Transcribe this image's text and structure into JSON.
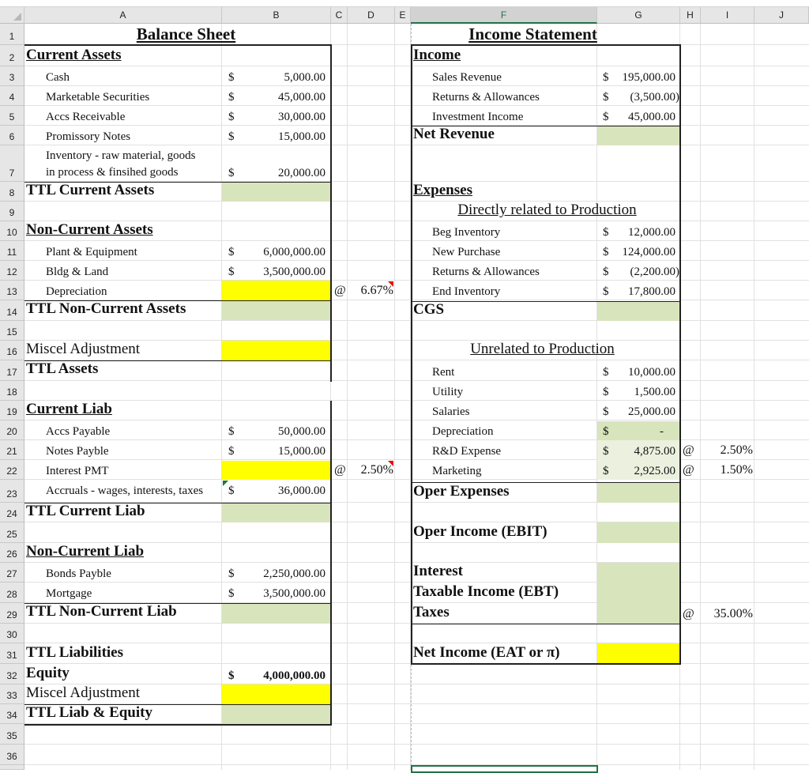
{
  "columns": [
    "A",
    "B",
    "C",
    "D",
    "E",
    "F",
    "G",
    "H",
    "I",
    "J"
  ],
  "rows": [
    "1",
    "2",
    "3",
    "4",
    "5",
    "6",
    "7",
    "8",
    "9",
    "10",
    "11",
    "12",
    "13",
    "14",
    "15",
    "16",
    "17",
    "18",
    "19",
    "20",
    "21",
    "22",
    "23",
    "24",
    "25",
    "26",
    "27",
    "28",
    "29",
    "30",
    "31",
    "32",
    "33",
    "34",
    "35",
    "36"
  ],
  "balance_sheet": {
    "title": "Balance Sheet",
    "current_assets_header": "Current Assets",
    "current_assets": [
      {
        "label": "Cash",
        "currency": "$",
        "value": "5,000.00"
      },
      {
        "label": "Marketable Securities",
        "currency": "$",
        "value": "45,000.00"
      },
      {
        "label": "Accs Receivable",
        "currency": "$",
        "value": "30,000.00"
      },
      {
        "label": "Promissory Notes",
        "currency": "$",
        "value": "15,000.00"
      },
      {
        "label_line1": "Inventory - raw material, goods",
        "label_line2": "in process & finsihed goods",
        "currency": "$",
        "value": "20,000.00"
      }
    ],
    "ttl_current_assets": "TTL Current Assets",
    "non_current_assets_header": "Non-Current Assets",
    "non_current_assets": [
      {
        "label": "Plant & Equipment",
        "currency": "$",
        "value": "6,000,000.00"
      },
      {
        "label": "Bldg & Land",
        "currency": "$",
        "value": "3,500,000.00"
      },
      {
        "label": "Depreciation",
        "at": "@",
        "rate": "6.67%"
      }
    ],
    "ttl_non_current_assets": "TTL Non-Current Assets",
    "miscel_adjustment_assets": "Miscel Adjustment",
    "ttl_assets": "TTL Assets",
    "current_liab_header": "Current Liab",
    "current_liab": [
      {
        "label": "Accs Payable",
        "currency": "$",
        "value": "50,000.00"
      },
      {
        "label": "Notes Payble",
        "currency": "$",
        "value": "15,000.00"
      },
      {
        "label": "Interest PMT",
        "at": "@",
        "rate": "2.50%"
      },
      {
        "label": "Accruals - wages, interests, taxes",
        "currency": "$",
        "value": "36,000.00"
      }
    ],
    "ttl_current_liab": "TTL Current Liab",
    "non_current_liab_header": "Non-Current Liab",
    "non_current_liab": [
      {
        "label": "Bonds Payble",
        "currency": "$",
        "value": "2,250,000.00"
      },
      {
        "label": "Mortgage",
        "currency": "$",
        "value": "3,500,000.00"
      }
    ],
    "ttl_non_current_liab": "TTL Non-Current Liab",
    "ttl_liabilities": "TTL Liabilities",
    "equity": {
      "label": "Equity",
      "currency": "$",
      "value": "4,000,000.00"
    },
    "miscel_adjustment_equity": "Miscel Adjustment",
    "ttl_liab_equity": "TTL Liab & Equity"
  },
  "income_statement": {
    "title": "Income Statement",
    "income_header": "Income",
    "income": [
      {
        "label": "Sales Revenue",
        "currency": "$",
        "value": "195,000.00"
      },
      {
        "label": "Returns & Allowances",
        "currency": "$",
        "value": "(3,500.00)"
      },
      {
        "label": "Investment Income",
        "currency": "$",
        "value": "45,000.00"
      }
    ],
    "net_revenue": "Net Revenue",
    "expenses_header": "Expenses",
    "direct_header": "Directly related to Production",
    "direct": [
      {
        "label": "Beg Inventory",
        "currency": "$",
        "value": "12,000.00"
      },
      {
        "label": "New Purchase",
        "currency": "$",
        "value": "124,000.00"
      },
      {
        "label": "Returns & Allowances",
        "currency": "$",
        "value": "(2,200.00)"
      },
      {
        "label": "End Inventory",
        "currency": "$",
        "value": "17,800.00"
      }
    ],
    "cgs": "CGS",
    "unrelated_header": "Unrelated to Production",
    "unrelated": [
      {
        "label": "Rent",
        "currency": "$",
        "value": "10,000.00"
      },
      {
        "label": "Utility",
        "currency": "$",
        "value": "1,500.00"
      },
      {
        "label": "Salaries",
        "currency": "$",
        "value": "25,000.00"
      },
      {
        "label": "Depreciation",
        "currency": "$",
        "value": "-"
      },
      {
        "label": "R&D Expense",
        "currency": "$",
        "value": "4,875.00",
        "at": "@",
        "rate": "2.50%"
      },
      {
        "label": "Marketing",
        "currency": "$",
        "value": "2,925.00",
        "at": "@",
        "rate": "1.50%"
      }
    ],
    "oper_expenses": "Oper Expenses",
    "oper_income": "Oper Income (EBIT)",
    "interest": "Interest",
    "taxable_income": "Taxable Income (EBT)",
    "taxes": {
      "label": "Taxes",
      "at": "@",
      "rate": "35.00%"
    },
    "net_income": "Net Income (EAT or π)"
  },
  "colors": {
    "total_fill": "#d8e4bc",
    "input_fill": "#ffff00",
    "formula_fill": "#ebf1de",
    "selection": "#217346"
  }
}
